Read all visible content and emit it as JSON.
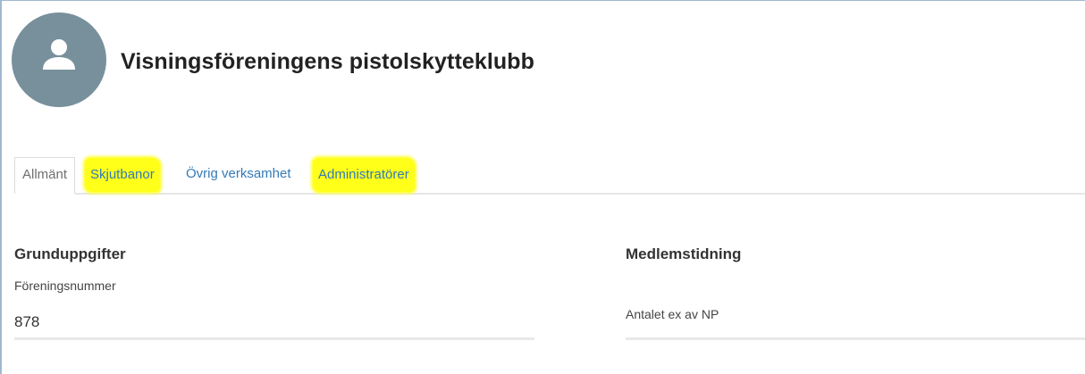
{
  "header": {
    "club_name": "Visningsföreningens pistolskytteklubb",
    "avatar_icon": "person-icon"
  },
  "tabs": [
    {
      "label": "Allmänt",
      "active": true,
      "highlighted": false
    },
    {
      "label": "Skjutbanor",
      "active": false,
      "highlighted": true
    },
    {
      "label": "Övrig verksamhet",
      "active": false,
      "highlighted": false
    },
    {
      "label": "Administratörer",
      "active": false,
      "highlighted": true
    }
  ],
  "basic_info": {
    "section_title": "Grunduppgifter",
    "club_number_label": "Föreningsnummer",
    "club_number_value": "878"
  },
  "member_magazine": {
    "section_title": "Medlemstidning",
    "copies_label": "Antalet ex av NP",
    "copies_value": ""
  },
  "colors": {
    "avatar_bg": "#78909c",
    "link": "#337ab7",
    "highlight": "#ffff1a"
  }
}
